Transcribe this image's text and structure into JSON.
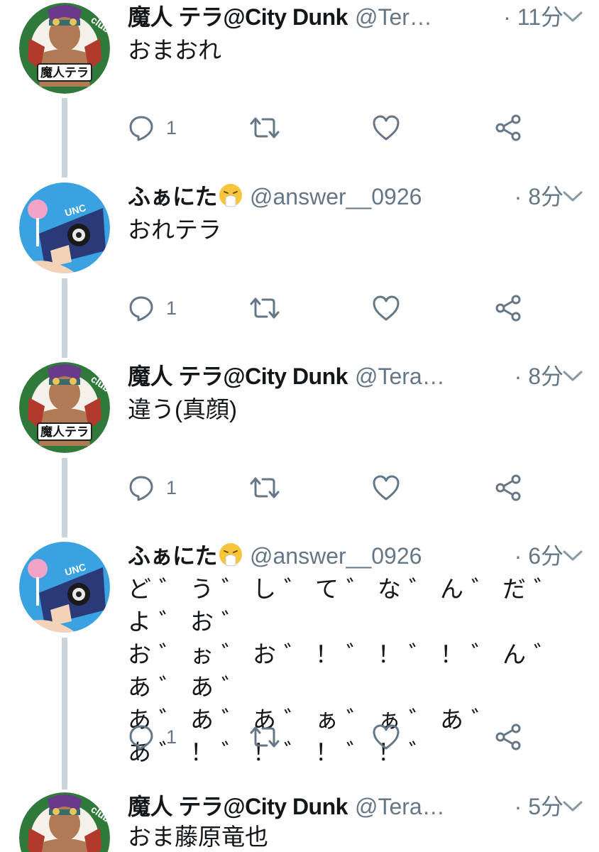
{
  "tweets": [
    {
      "name": "魔人 テラ@City Dunk",
      "handle": "@Ter…",
      "time": "· 11分",
      "avatar": "tera",
      "lines": [
        "おまおれ"
      ],
      "reply_count": "1"
    },
    {
      "name": "ふぁにた",
      "handle": "@answer__0926",
      "time": "· 8分",
      "avatar": "fanita",
      "name_emoji": "sneezing-face-emoji",
      "lines": [
        "おれテラ"
      ],
      "reply_count": "1"
    },
    {
      "name": "魔人 テラ@City Dunk",
      "handle": "@Tera…",
      "time": "· 8分",
      "avatar": "tera",
      "lines": [
        "違う(真顔)"
      ],
      "reply_count": "1"
    },
    {
      "name": "ふぁにた",
      "handle": "@answer__0926",
      "time": "· 6分",
      "avatar": "fanita",
      "name_emoji": "sneezing-face-emoji",
      "lines": [
        "ど゛う゛し゛て゛な゛ん゛だ゛よ゛お゛",
        "お゛ぉ゛お゛！゛！゛！゛ん゛あ゛あ゛",
        "あ゛あ゛あ゛ぁ゛ぁ゛あ゛",
        "あ゛！゛！゛！゛！゛"
      ],
      "reply_count": "1"
    },
    {
      "name": "魔人 テラ@City Dunk",
      "handle": "@Tera…",
      "time": "· 5分",
      "avatar": "tera",
      "lines": [
        "おま藤原竜也"
      ]
    }
  ],
  "avatar_texts": {
    "tera_badge": "魔人テラ",
    "tera_ring": "clubte",
    "camera_label": "UNC"
  },
  "icons": [
    "reply-icon",
    "retweet-icon",
    "like-icon",
    "share-icon",
    "chevron-down-icon"
  ],
  "colors": {
    "text": "#14171a",
    "secondary": "#657786",
    "thread_line": "#c9d3db"
  }
}
